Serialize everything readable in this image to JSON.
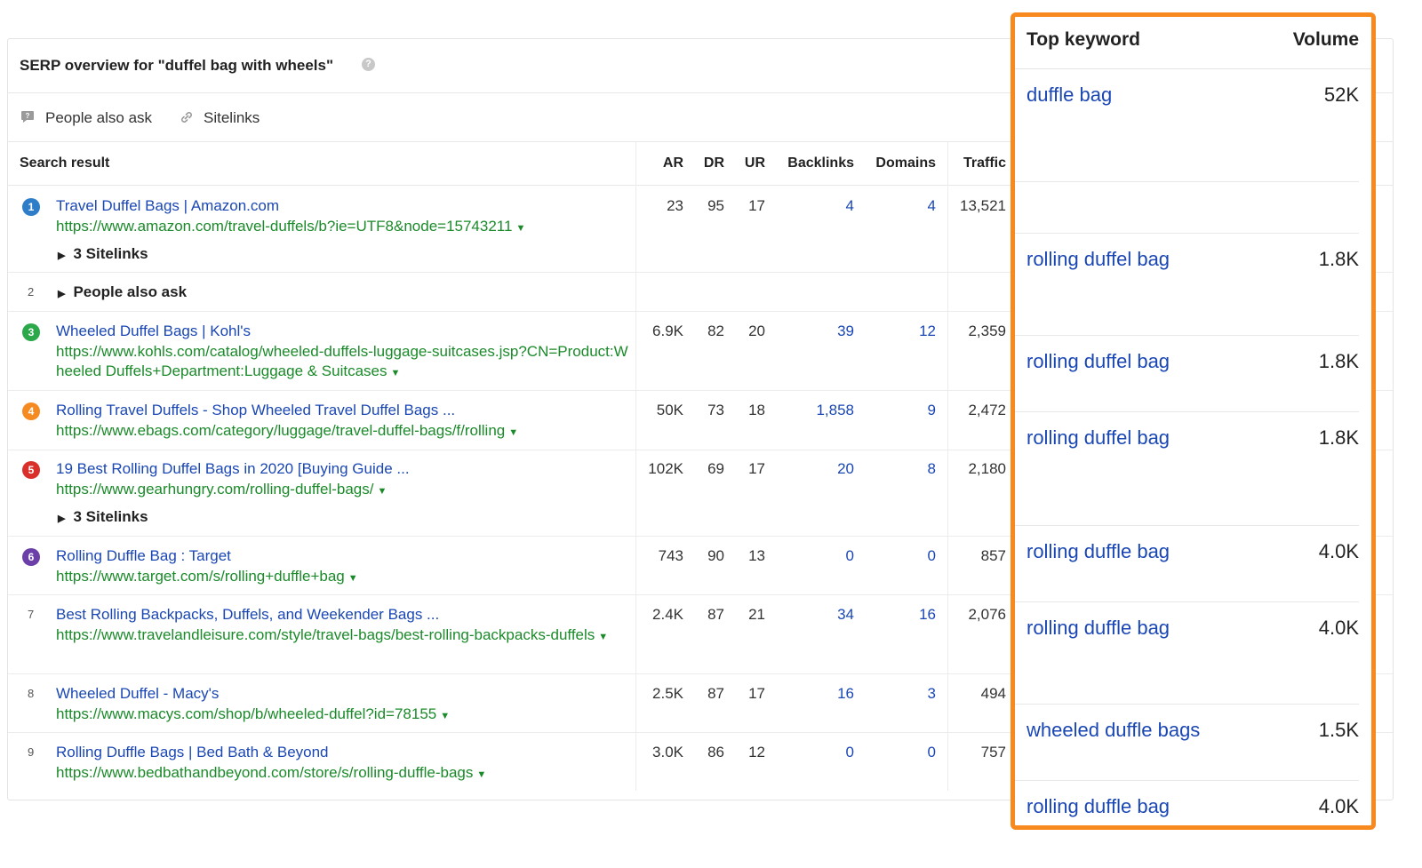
{
  "panel": {
    "title": "SERP overview for \"duffel bag with wheels\"",
    "help_icon": "?"
  },
  "features": [
    {
      "icon": "question-chat-icon",
      "label": "People also ask"
    },
    {
      "icon": "link-icon",
      "label": "Sitelinks"
    }
  ],
  "columns": {
    "search_result": "Search result",
    "ar": "AR",
    "dr": "DR",
    "ur": "UR",
    "backlinks": "Backlinks",
    "domains": "Domains",
    "traffic": "Traffic"
  },
  "rows": [
    {
      "num": "1",
      "badge_color": "#2d7dc8",
      "title": "Travel Duffel Bags | Amazon.com",
      "url": "https://www.amazon.com/travel-duffels/b?ie=UTF8&node=15743211",
      "ar": "23",
      "dr": "95",
      "ur": "17",
      "backlinks": "4",
      "domains": "4",
      "traffic": "13,521",
      "sub": "3 Sitelinks"
    },
    {
      "num": "2",
      "sub": "People also ask"
    },
    {
      "num": "3",
      "badge_color": "#2aa84a",
      "title": "Wheeled Duffel Bags | Kohl's",
      "url": "https://www.kohls.com/catalog/wheeled-duffels-luggage-suitcases.jsp?CN=Product:Wheeled Duffels+Department:Luggage & Suitcases",
      "ar": "6.9K",
      "dr": "82",
      "ur": "20",
      "backlinks": "39",
      "domains": "12",
      "traffic": "2,359"
    },
    {
      "num": "4",
      "badge_color": "#f58a21",
      "title": "Rolling Travel Duffels - Shop Wheeled Travel Duffel Bags ...",
      "url": "https://www.ebags.com/category/luggage/travel-duffel-bags/f/rolling",
      "ar": "50K",
      "dr": "73",
      "ur": "18",
      "backlinks": "1,858",
      "domains": "9",
      "traffic": "2,472"
    },
    {
      "num": "5",
      "badge_color": "#d9302b",
      "title": "19 Best Rolling Duffel Bags in 2020 [Buying Guide ...",
      "url": "https://www.gearhungry.com/rolling-duffel-bags/",
      "ar": "102K",
      "dr": "69",
      "ur": "17",
      "backlinks": "20",
      "domains": "8",
      "traffic": "2,180",
      "sub": "3 Sitelinks"
    },
    {
      "num": "6",
      "badge_color": "#6c3fa8",
      "title": "Rolling Duffle Bag : Target",
      "url": "https://www.target.com/s/rolling+duffle+bag",
      "ar": "743",
      "dr": "90",
      "ur": "13",
      "backlinks": "0",
      "domains": "0",
      "traffic": "857"
    },
    {
      "num": "7",
      "title": "Best Rolling Backpacks, Duffels, and Weekender Bags ...",
      "url": "https://www.travelandleisure.com/style/travel-bags/best-rolling-backpacks-duffels",
      "ar": "2.4K",
      "dr": "87",
      "ur": "21",
      "backlinks": "34",
      "domains": "16",
      "traffic": "2,076"
    },
    {
      "num": "8",
      "title": "Wheeled Duffel - Macy's",
      "url": "https://www.macys.com/shop/b/wheeled-duffel?id=78155",
      "ar": "2.5K",
      "dr": "87",
      "ur": "17",
      "backlinks": "16",
      "domains": "3",
      "traffic": "494"
    },
    {
      "num": "9",
      "title": "Rolling Duffle Bags | Bed Bath & Beyond",
      "url": "https://www.bedbathandbeyond.com/store/s/rolling-duffle-bags",
      "ar": "3.0K",
      "dr": "86",
      "ur": "12",
      "backlinks": "0",
      "domains": "0",
      "traffic": "757"
    }
  ],
  "caret": "▼",
  "triangle": "▶",
  "keywords": {
    "header_keyword": "Top keyword",
    "header_volume": "Volume",
    "items": [
      {
        "term": "duffle bag",
        "volume": "52K"
      },
      {
        "term": "",
        "volume": ""
      },
      {
        "term": "rolling duffel bag",
        "volume": "1.8K"
      },
      {
        "term": "rolling duffel bag",
        "volume": "1.8K"
      },
      {
        "term": "rolling duffel bag",
        "volume": "1.8K"
      },
      {
        "term": "rolling duffle bag",
        "volume": "4.0K"
      },
      {
        "term": "rolling duffle bag",
        "volume": "4.0K"
      },
      {
        "term": "wheeled duffle bags",
        "volume": "1.5K"
      },
      {
        "term": "rolling duffle bag",
        "volume": "4.0K"
      }
    ]
  },
  "colors": {
    "highlight": "#f7891f",
    "link": "#1a47b4",
    "url": "#1b8a2a"
  }
}
